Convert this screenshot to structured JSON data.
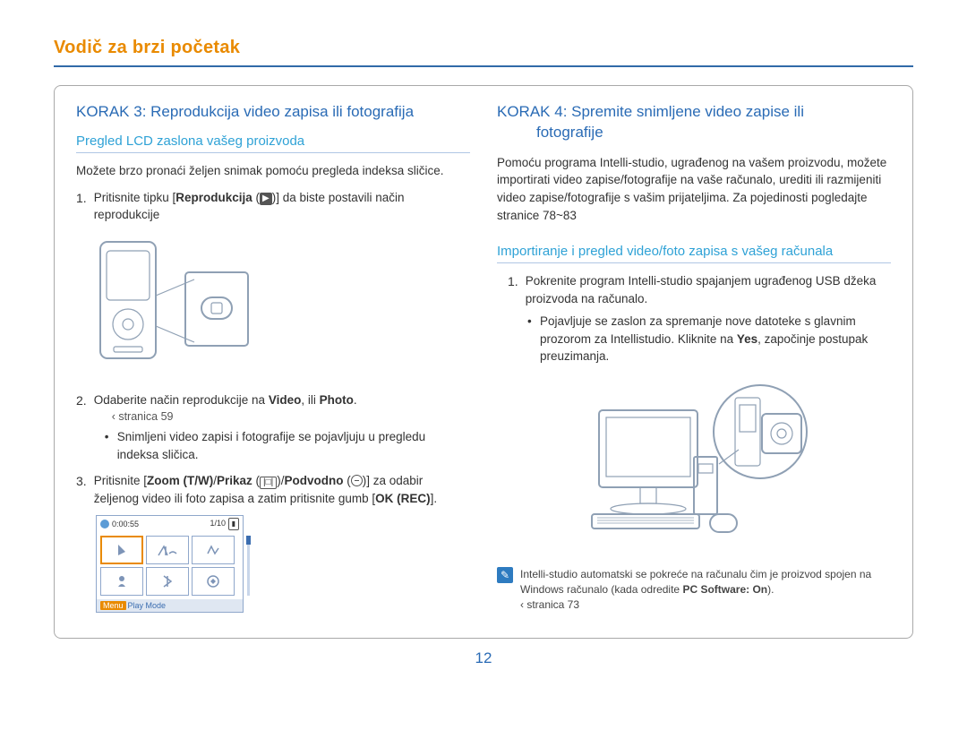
{
  "title": "Vodič za brzi početak",
  "page_number": "12",
  "left": {
    "step_title": "KORAK 3: Reprodukcija video zapisa ili fotografija",
    "sub_title": "Pregled LCD zaslona vašeg proizvoda",
    "intro": "Možete brzo pronaći željen snimak pomoću pregleda indeksa sličice.",
    "item1_pre": "Pritisnite tipku [",
    "item1_bold": "Reprodukcija",
    "item1_post": " (▶)] da biste postavili način reprodukcije",
    "item2_pre": "Odaberite način reprodukcije na ",
    "item2_b1": "Video",
    "item2_mid": ", ili ",
    "item2_b2": "Photo",
    "item2_post": ".",
    "item2_ref": "‹ stranica 59",
    "item2_bullet": "Snimljeni video zapisi i fotografije se pojavljuju u pregledu indeksa sličica.",
    "item3_pre": "Pritisnite [",
    "item3_b1": "Zoom (T/W)",
    "item3_sep1": "/",
    "item3_b2": "Prikaz",
    "item3_mid1": " (",
    "item3_mid1b": ")/",
    "item3_b3": "Podvodno",
    "item3_post": " ( )] za odabir željenog video ili foto zapisa a zatim pritisnite gumb [",
    "item3_b4": "OK (REC)",
    "item3_end": "].",
    "lcd": {
      "time": "0:00:55",
      "count": "1/10",
      "mode_label": "Play Mode",
      "menu": "Menu"
    }
  },
  "right": {
    "step_title_l1": "KORAK 4: Spremite snimljene video zapise ili",
    "step_title_l2": "fotografije",
    "para": "Pomoću programa Intelli-studio, ugrađenog na vašem proizvodu, možete importirati video zapise/fotografije na vaše računalo, urediti ili razmijeniti video zapise/fotografije s vašim prijateljima. Za pojedinosti pogledajte stranice 78~83",
    "sub_title": "Importiranje i pregled video/foto zapisa s vašeg računala",
    "item1": "Pokrenite program Intelli-studio spajanjem ugrađenog USB džeka proizvoda na računalo.",
    "bullet_pre": "Pojavljuje se zaslon za spremanje nove datoteke s glavnim prozorom za Intellistudio. Kliknite na ",
    "bullet_b": "Yes",
    "bullet_post": ", započinje postupak preuzimanja.",
    "note_pre": "Intelli-studio automatski se pokreće na računalu čim je proizvod spojen na Windows računalo (kada odredite ",
    "note_b": "PC Software: On",
    "note_post": ").",
    "note_ref": "‹ stranica 73"
  }
}
